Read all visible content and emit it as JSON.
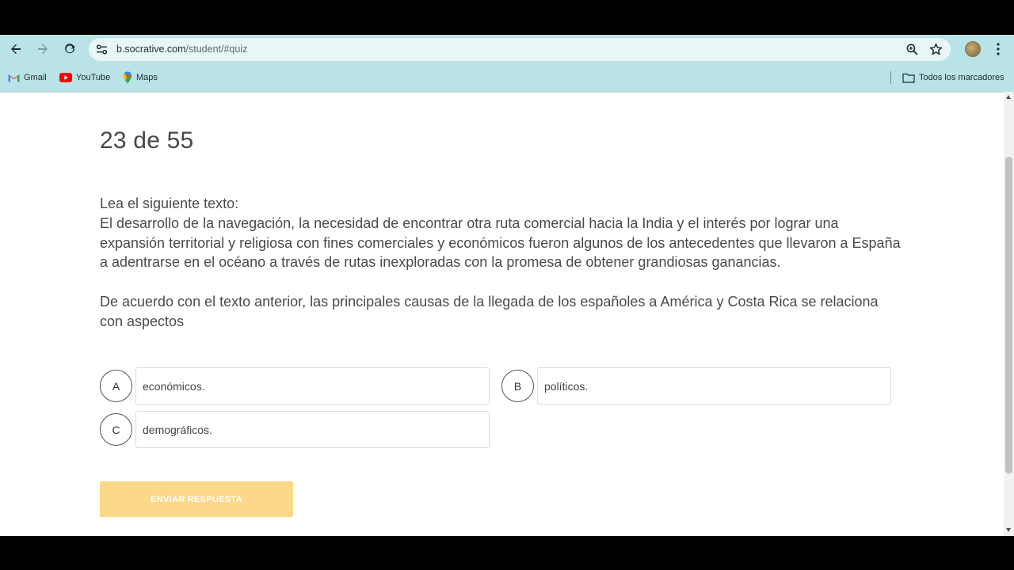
{
  "browser": {
    "url_host": "b.socrative.com",
    "url_path": "/student/#quiz",
    "bookmarks": [
      {
        "label": "Gmail",
        "icon": "gmail-icon"
      },
      {
        "label": "YouTube",
        "icon": "youtube-icon"
      },
      {
        "label": "Maps",
        "icon": "maps-icon"
      }
    ],
    "all_bookmarks_label": "Todos los marcadores"
  },
  "quiz": {
    "progress": "23 de 55",
    "question_lines": [
      "Lea el siguiente texto:",
      "El desarrollo de la navegación, la necesidad de encontrar otra ruta comercial hacia la India y el interés por lograr una expansión territorial y religiosa con fines comerciales y económicos fueron algunos de los antecedentes que llevaron a España a adentrarse en el océano a través de rutas inexploradas con la promesa de obtener grandiosas ganancias."
    ],
    "prompt": "De acuerdo con el texto anterior, las principales causas de la llegada de los españoles a América y Costa Rica se relaciona con aspectos",
    "answers": [
      {
        "letter": "A",
        "text": "económicos."
      },
      {
        "letter": "B",
        "text": "políticos."
      },
      {
        "letter": "C",
        "text": "demográficos."
      }
    ],
    "submit_label": "ENVIAR RESPUESTA"
  },
  "colors": {
    "chrome_bg": "#b9e3e6",
    "submit_bg": "#fdd888"
  }
}
